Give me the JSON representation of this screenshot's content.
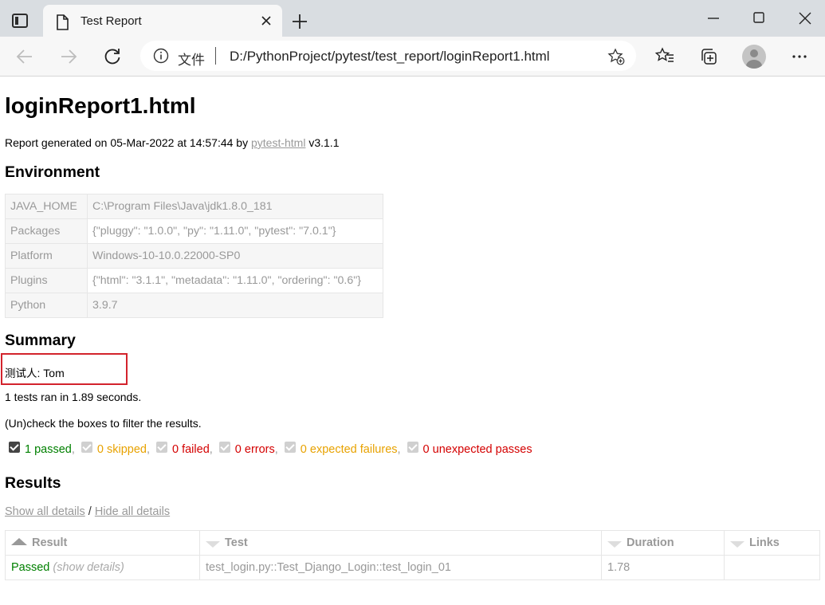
{
  "browser": {
    "tab_title": "Test Report",
    "address_label": "文件",
    "address_url": "D:/PythonProject/pytest/test_report/loginReport1.html"
  },
  "report": {
    "title": "loginReport1.html",
    "generated_prefix": "Report generated on 05-Mar-2022 at 14:57:44 by ",
    "generator_link": "pytest-html",
    "generator_version": " v3.1.1"
  },
  "environment": {
    "heading": "Environment",
    "rows": [
      {
        "key": "JAVA_HOME",
        "value": "C:\\Program Files\\Java\\jdk1.8.0_181"
      },
      {
        "key": "Packages",
        "value": "{\"pluggy\": \"1.0.0\", \"py\": \"1.11.0\", \"pytest\": \"7.0.1\"}"
      },
      {
        "key": "Platform",
        "value": "Windows-10-10.0.22000-SP0"
      },
      {
        "key": "Plugins",
        "value": "{\"html\": \"3.1.1\", \"metadata\": \"1.11.0\", \"ordering\": \"0.6\"}"
      },
      {
        "key": "Python",
        "value": "3.9.7"
      }
    ]
  },
  "summary": {
    "heading": "Summary",
    "tester_label": "测试人",
    "tester_value": ": Tom",
    "ran_text": "1 tests ran in 1.89 seconds.",
    "uncheck_text": "(Un)check the boxes to filter the results.",
    "filters": {
      "passed": "1 passed",
      "skipped": "0 skipped",
      "failed": "0 failed",
      "errors": "0 errors",
      "xfailed": "0 expected failures",
      "xpassed": "0 unexpected passes",
      "sep": ","
    },
    "colors": {
      "passed": "#008000",
      "skipped": "#e8a200",
      "failed": "#d40000",
      "highlight_box": "#d3232c"
    }
  },
  "results": {
    "heading": "Results",
    "show_all": "Show all details",
    "slash": " / ",
    "hide_all": "Hide all details",
    "columns": {
      "result": "Result",
      "test": "Test",
      "duration": "Duration",
      "links": "Links"
    },
    "rows": [
      {
        "result": "Passed",
        "details_toggle": "(show details)",
        "test": "test_login.py::Test_Django_Login::test_login_01",
        "duration": "1.78",
        "links": ""
      }
    ]
  }
}
